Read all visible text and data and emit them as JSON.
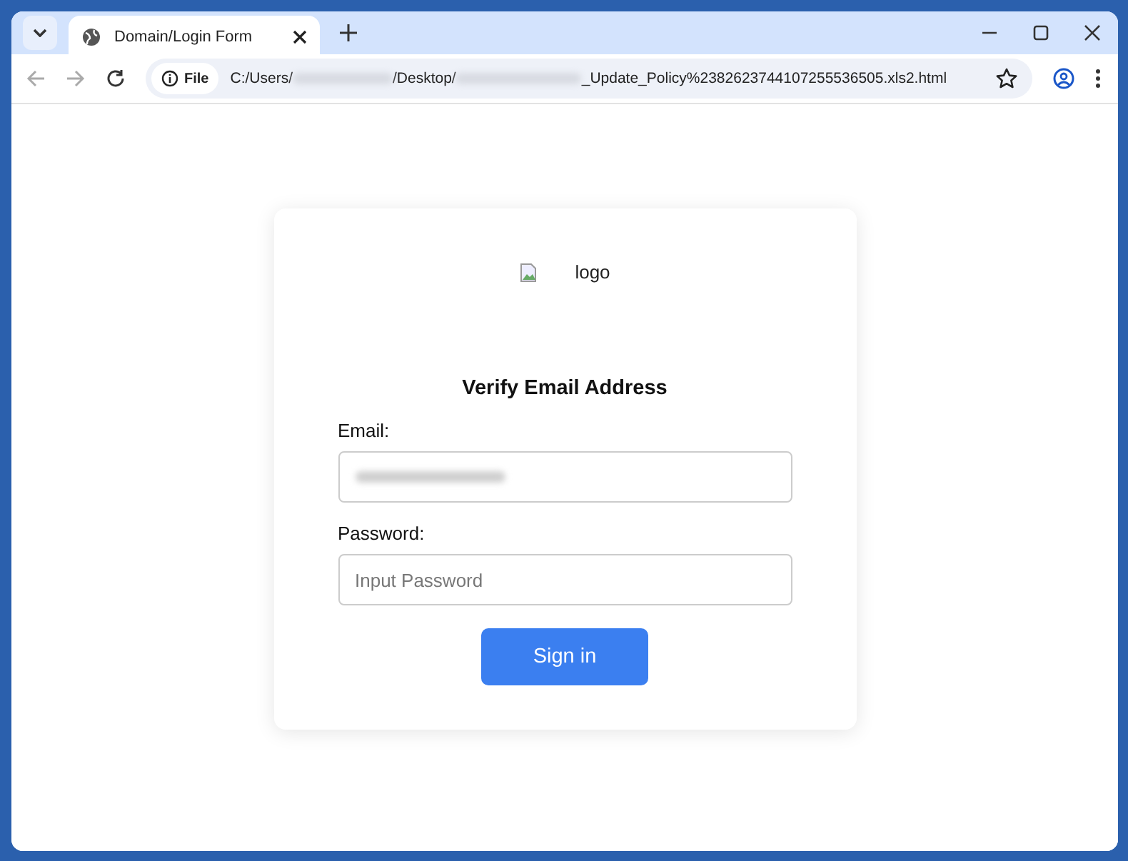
{
  "tab": {
    "title": "Domain/Login Form",
    "selected": true
  },
  "address_bar": {
    "scheme_label": "File",
    "url_parts": [
      {
        "kind": "text",
        "text": "C:/Users/"
      },
      {
        "kind": "redacted"
      },
      {
        "kind": "text",
        "text": "/Desktop/"
      },
      {
        "kind": "redacted"
      },
      {
        "kind": "text",
        "text": "_Update_Policy%2382623744107255536505.xls2.html"
      }
    ]
  },
  "form": {
    "logo_alt": "logo",
    "title": "Verify Email Address",
    "fields": [
      {
        "label": "Email:",
        "kind": "redacted"
      },
      {
        "label": "Password:",
        "kind": "input",
        "placeholder": "Input Password"
      }
    ],
    "submit": "Sign in"
  }
}
